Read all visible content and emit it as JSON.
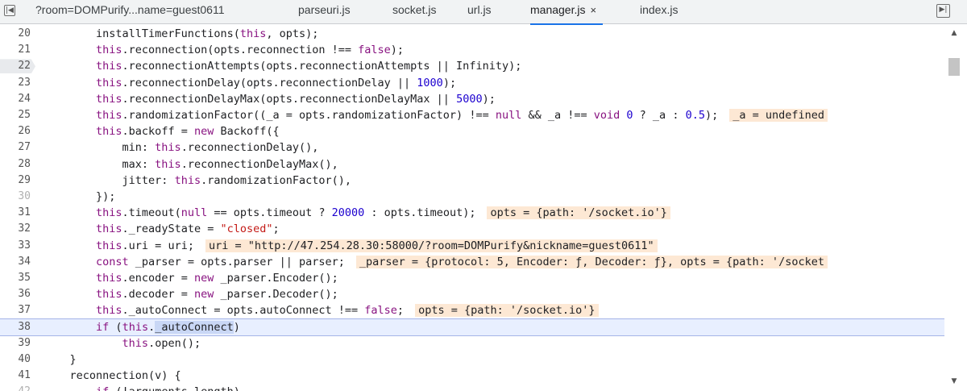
{
  "tabs": [
    {
      "label": "?room=DOMPurify...name=guest0611",
      "active": false
    },
    {
      "label": "parseuri.js",
      "active": false
    },
    {
      "label": "socket.js",
      "active": false
    },
    {
      "label": "url.js",
      "active": false
    },
    {
      "label": "manager.js",
      "active": true,
      "close_glyph": "×"
    },
    {
      "label": "index.js",
      "active": false
    }
  ],
  "left_nav_icon": "step-back-icon",
  "right_nav_icon": "step-forward-icon",
  "current_line": 38,
  "breakpoint_line": 22,
  "lines": [
    {
      "n": "20",
      "t": [
        [
          "p",
          "        installTimerFunctions("
        ],
        [
          "k",
          "this"
        ],
        [
          "p",
          ", opts);"
        ]
      ]
    },
    {
      "n": "21",
      "t": [
        [
          "p",
          "        "
        ],
        [
          "k",
          "this"
        ],
        [
          "p",
          ".reconnection(opts.reconnection !== "
        ],
        [
          "k",
          "false"
        ],
        [
          "p",
          ");"
        ]
      ]
    },
    {
      "n": "22",
      "t": [
        [
          "p",
          "        "
        ],
        [
          "k",
          "this"
        ],
        [
          "p",
          ".reconnectionAttempts(opts.reconnectionAttempts || Infinity);"
        ]
      ]
    },
    {
      "n": "23",
      "t": [
        [
          "p",
          "        "
        ],
        [
          "k",
          "this"
        ],
        [
          "p",
          ".reconnectionDelay(opts.reconnectionDelay || "
        ],
        [
          "n",
          "1000"
        ],
        [
          "p",
          ");"
        ]
      ]
    },
    {
      "n": "24",
      "t": [
        [
          "p",
          "        "
        ],
        [
          "k",
          "this"
        ],
        [
          "p",
          ".reconnectionDelayMax(opts.reconnectionDelayMax || "
        ],
        [
          "n",
          "5000"
        ],
        [
          "p",
          ");"
        ]
      ]
    },
    {
      "n": "25",
      "t": [
        [
          "p",
          "        "
        ],
        [
          "k",
          "this"
        ],
        [
          "p",
          ".randomizationFactor((_a = opts.randomizationFactor) !== "
        ],
        [
          "k",
          "null"
        ],
        [
          "p",
          " && _a !== "
        ],
        [
          "k",
          "void"
        ],
        [
          "p",
          " "
        ],
        [
          "n",
          "0"
        ],
        [
          "p",
          " ? _a : "
        ],
        [
          "n",
          "0.5"
        ],
        [
          "p",
          ");"
        ],
        [
          "e",
          "_a = undefined"
        ]
      ]
    },
    {
      "n": "26",
      "t": [
        [
          "p",
          "        "
        ],
        [
          "k",
          "this"
        ],
        [
          "p",
          ".backoff = "
        ],
        [
          "k",
          "new"
        ],
        [
          "p",
          " Backoff({"
        ]
      ]
    },
    {
      "n": "27",
      "t": [
        [
          "p",
          "            min: "
        ],
        [
          "k",
          "this"
        ],
        [
          "p",
          ".reconnectionDelay(),"
        ]
      ]
    },
    {
      "n": "28",
      "t": [
        [
          "p",
          "            max: "
        ],
        [
          "k",
          "this"
        ],
        [
          "p",
          ".reconnectionDelayMax(),"
        ]
      ]
    },
    {
      "n": "29",
      "t": [
        [
          "p",
          "            jitter: "
        ],
        [
          "k",
          "this"
        ],
        [
          "p",
          ".randomizationFactor(),"
        ]
      ]
    },
    {
      "n": "30",
      "faded": true,
      "t": [
        [
          "p",
          "        });"
        ]
      ]
    },
    {
      "n": "31",
      "t": [
        [
          "p",
          "        "
        ],
        [
          "k",
          "this"
        ],
        [
          "p",
          ".timeout("
        ],
        [
          "k",
          "null"
        ],
        [
          "p",
          " == opts.timeout ? "
        ],
        [
          "n",
          "20000"
        ],
        [
          "p",
          " : opts.timeout);"
        ],
        [
          "e",
          "opts = {path: '/socket.io'}"
        ]
      ]
    },
    {
      "n": "32",
      "t": [
        [
          "p",
          "        "
        ],
        [
          "k",
          "this"
        ],
        [
          "p",
          "._readyState = "
        ],
        [
          "s",
          "\"closed\""
        ],
        [
          "p",
          ";"
        ]
      ]
    },
    {
      "n": "33",
      "t": [
        [
          "p",
          "        "
        ],
        [
          "k",
          "this"
        ],
        [
          "p",
          ".uri = uri;"
        ],
        [
          "e",
          "uri = \"http://47.254.28.30:58000/?room=DOMPurify&nickname=guest0611\""
        ]
      ]
    },
    {
      "n": "34",
      "t": [
        [
          "p",
          "        "
        ],
        [
          "k",
          "const"
        ],
        [
          "p",
          " _parser = opts.parser || parser;"
        ],
        [
          "e",
          "_parser = {protocol: 5, Encoder: ƒ, Decoder: ƒ}, opts = {path: '/socket"
        ]
      ]
    },
    {
      "n": "35",
      "t": [
        [
          "p",
          "        "
        ],
        [
          "k",
          "this"
        ],
        [
          "p",
          ".encoder = "
        ],
        [
          "k",
          "new"
        ],
        [
          "p",
          " _parser.Encoder();"
        ]
      ]
    },
    {
      "n": "36",
      "t": [
        [
          "p",
          "        "
        ],
        [
          "k",
          "this"
        ],
        [
          "p",
          ".decoder = "
        ],
        [
          "k",
          "new"
        ],
        [
          "p",
          " _parser.Decoder();"
        ]
      ]
    },
    {
      "n": "37",
      "t": [
        [
          "p",
          "        "
        ],
        [
          "k",
          "this"
        ],
        [
          "p",
          "._autoConnect = opts.autoConnect !== "
        ],
        [
          "k",
          "false"
        ],
        [
          "p",
          ";"
        ],
        [
          "e",
          "opts = {path: '/socket.io'}"
        ]
      ]
    },
    {
      "n": "38",
      "t": [
        [
          "p",
          "        "
        ],
        [
          "k",
          "if"
        ],
        [
          "p",
          " ("
        ],
        [
          "k",
          "this"
        ],
        [
          "p",
          "."
        ],
        [
          "sel",
          "_autoConnect"
        ],
        [
          "p",
          ")"
        ]
      ]
    },
    {
      "n": "39",
      "t": [
        [
          "p",
          "            "
        ],
        [
          "k",
          "this"
        ],
        [
          "p",
          ".open();"
        ]
      ]
    },
    {
      "n": "40",
      "t": [
        [
          "p",
          "    }"
        ]
      ]
    },
    {
      "n": "41",
      "t": [
        [
          "p",
          "    reconnection(v) {"
        ]
      ]
    },
    {
      "n": "42",
      "faded": true,
      "t": [
        [
          "p",
          "        "
        ],
        [
          "k",
          "if"
        ],
        [
          "p",
          " (!arguments.length)"
        ]
      ]
    }
  ]
}
